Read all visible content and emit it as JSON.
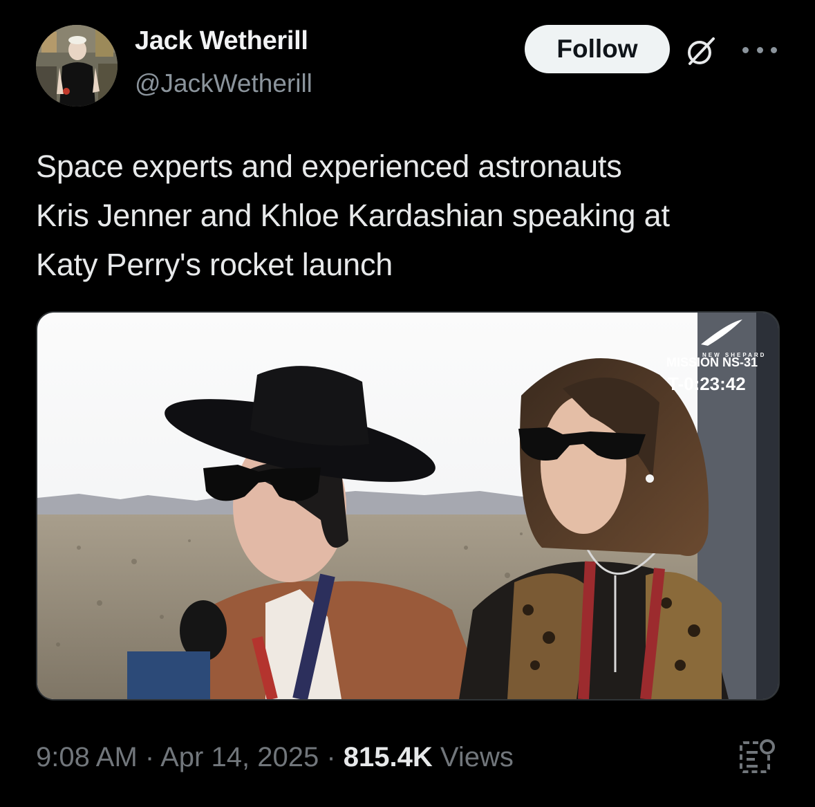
{
  "author": {
    "name": "Jack Wetherill",
    "handle": "@JackWetherill"
  },
  "actions": {
    "follow_label": "Follow",
    "grok_icon": "grok-icon",
    "more_icon": "more-dots-icon"
  },
  "tweet": {
    "text_lines": [
      "Space experts and experienced astronauts",
      "Kris Jenner and Khloe Kardashian speaking at",
      "Katy Perry's rocket launch"
    ]
  },
  "media": {
    "overlay": {
      "brand": "NEW SHEPARD",
      "mission": "MISSION NS-31",
      "countdown": "T-0:23:42"
    }
  },
  "meta": {
    "time": "9:08 AM",
    "separator": "·",
    "date": "Apr 14, 2025",
    "views_count": "815.4K",
    "views_label": "Views"
  },
  "colors": {
    "background": "#000000",
    "text": "#e7e9ea",
    "secondary": "#71767b",
    "follow_bg": "#eff3f4"
  }
}
